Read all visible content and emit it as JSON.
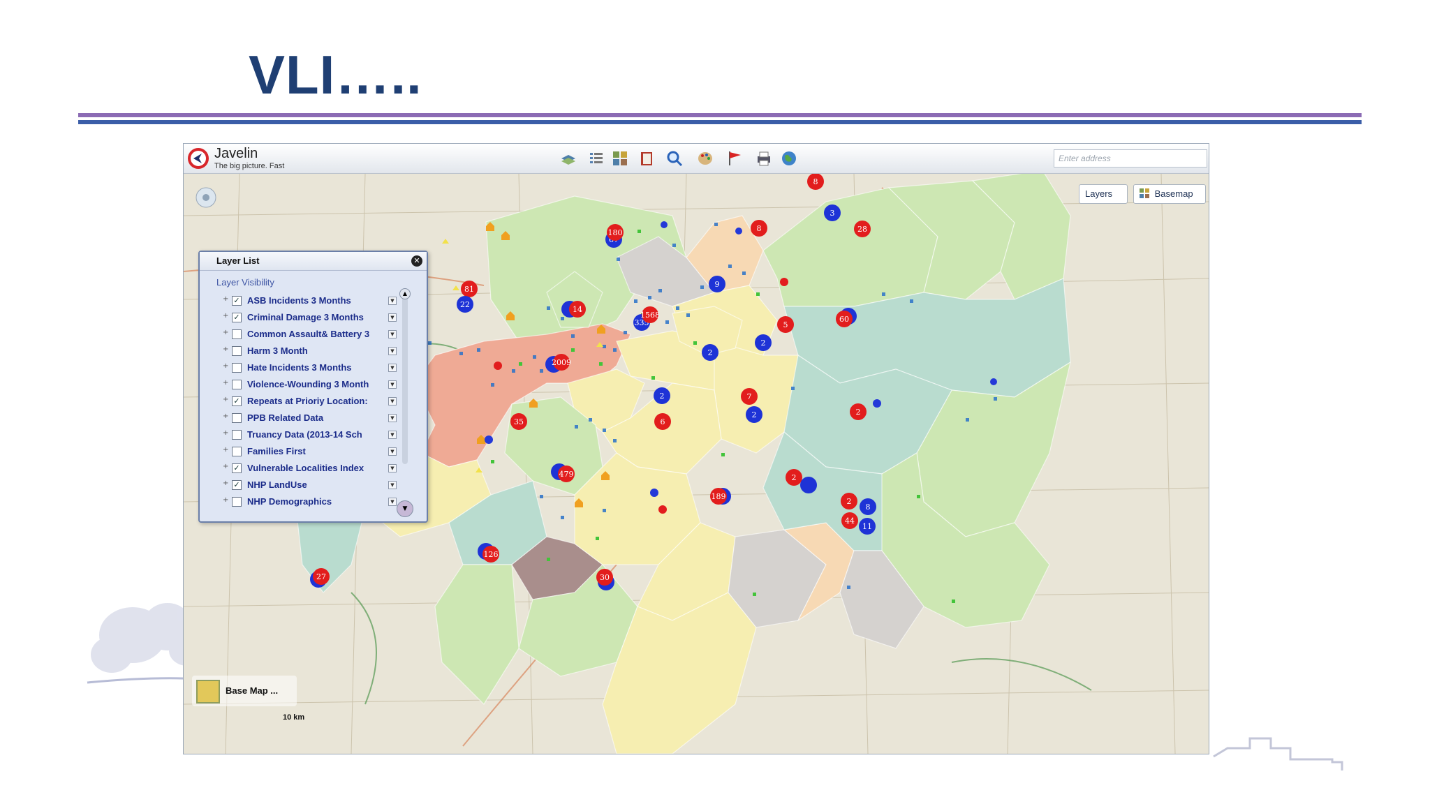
{
  "slide": {
    "title": "VLI….."
  },
  "app": {
    "name": "Javelin",
    "tagline": "The big picture. Fast",
    "address_placeholder": "Enter address",
    "toolbar_icons": [
      "layers-stack-icon",
      "legend-list-icon",
      "grid-view-icon",
      "book-icon",
      "search-zoom-icon",
      "palette-icon",
      "flag-icon",
      "print-icon",
      "globe-icon"
    ]
  },
  "map": {
    "layers_button": "Layers",
    "basemap_button": "Basemap",
    "basemap_control": "Base Map ...",
    "scale": "10 km",
    "colors": {
      "red": "#e21d1d",
      "blue": "#1e33d6",
      "green_region": "#cde7b3",
      "teal_region": "#b9dccf",
      "pink_region": "#efaa95",
      "yellow_region": "#f6eeb1",
      "grey_region": "#d5d2cf",
      "mauve_region": "#a98e8c",
      "peach_region": "#f7d9b4"
    },
    "cluster_labels": [
      "8",
      "3",
      "28",
      "180",
      "67",
      "8",
      "81",
      "22",
      "9",
      "14",
      "1568",
      "335",
      "5",
      "60",
      "2",
      "2",
      "2009",
      "230",
      "2",
      "7",
      "2",
      "2",
      "35",
      "6",
      "2",
      "151",
      "479",
      "189",
      "2",
      "8",
      "44",
      "11",
      "126",
      "27",
      "30"
    ]
  },
  "layer_panel": {
    "title": "Layer List",
    "subtitle": "Layer Visibility",
    "layers": [
      {
        "label": "ASB Incidents 3 Months",
        "checked": "✓"
      },
      {
        "label": "Criminal Damage 3 Months",
        "checked": "✓"
      },
      {
        "label": "Common Assault& Battery 3",
        "checked": ""
      },
      {
        "label": "Harm 3 Month",
        "checked": ""
      },
      {
        "label": "Hate Incidents 3 Months",
        "checked": ""
      },
      {
        "label": "Violence-Wounding 3 Month",
        "checked": ""
      },
      {
        "label": "Repeats at Prioriy Location:",
        "checked": "✓"
      },
      {
        "label": "PPB Related Data",
        "checked": ""
      },
      {
        "label": "Truancy Data (2013-14 Sch",
        "checked": ""
      },
      {
        "label": "Families First",
        "checked": ""
      },
      {
        "label": "Vulnerable Localities Index",
        "checked": "✓"
      },
      {
        "label": "NHP LandUse",
        "checked": "✓"
      },
      {
        "label": "NHP Demographics",
        "checked": ""
      }
    ]
  }
}
